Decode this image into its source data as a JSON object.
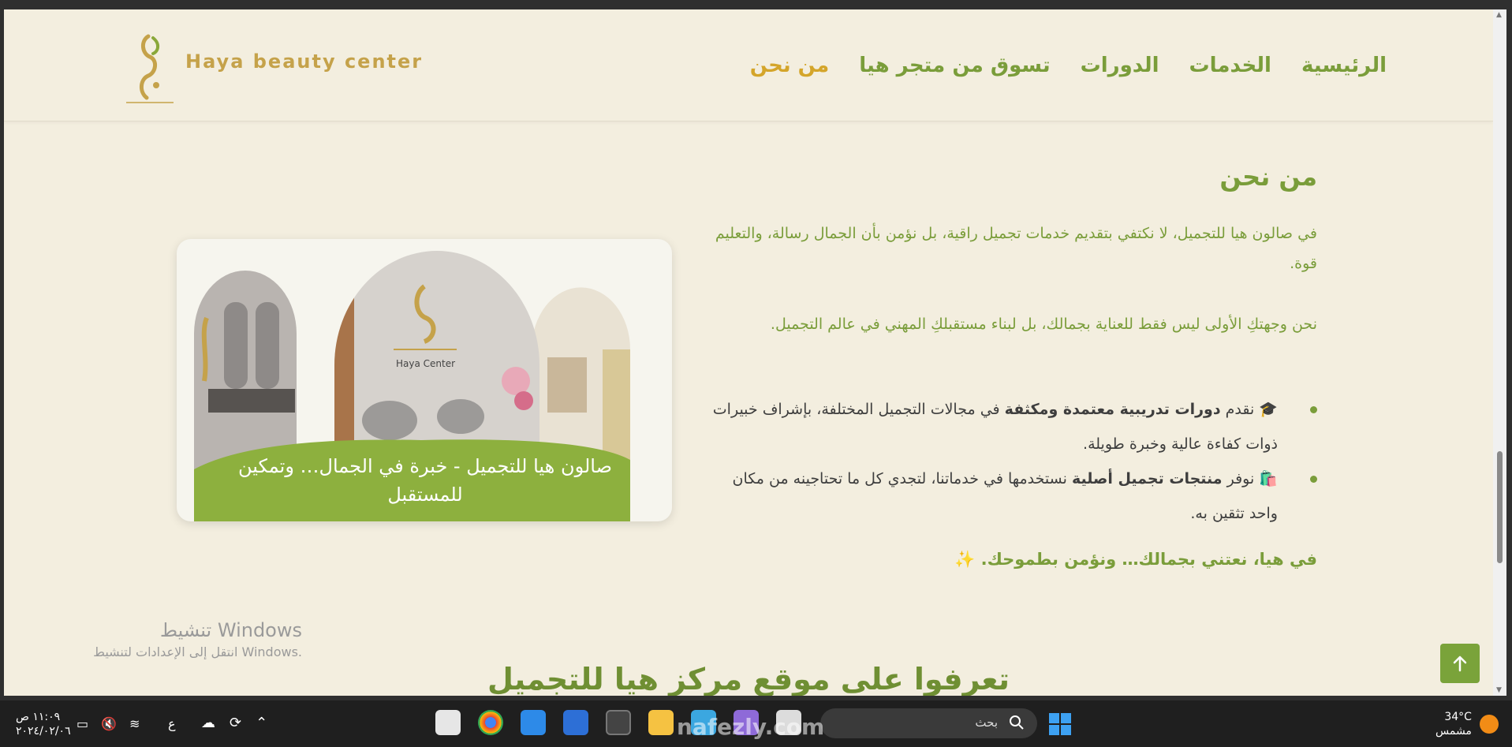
{
  "header": {
    "brand": "Haya beauty center",
    "nav": [
      {
        "label": "الرئيسية"
      },
      {
        "label": "الخدمات"
      },
      {
        "label": "الدورات"
      },
      {
        "label": "تسوق من متجر هيا"
      },
      {
        "label": "من نحن"
      }
    ],
    "active_index": 4
  },
  "about": {
    "title": "من نحن",
    "p1": "في صالون هيا للتجميل، لا نكتفي بتقديم خدمات تجميل راقية، بل نؤمن بأن الجمال رسالة، والتعليم قوة.",
    "p2": "نحن وجهتكِ الأولى ليس فقط للعناية بجمالك، بل لبناء مستقبلكِ المهني في عالم التجميل.",
    "li1": {
      "icon": "graduation-cap-icon",
      "pre": "نقدم ",
      "bold": "دورات تدريبية معتمدة ومكثفة",
      "post": " في مجالات التجميل المختلفة، بإشراف خبيرات ذوات كفاءة عالية وخبرة طويلة."
    },
    "li2": {
      "icon": "shopping-bag-icon",
      "pre": "نوفر ",
      "bold": "منتجات تجميل أصلية",
      "post": " نستخدمها في خدماتنا، لتجدي كل ما تحتاجينه من مكان واحد تثقين به."
    },
    "closing": "في هيا، نعتني بجمالك… ونؤمن بطموحك.",
    "closing_icon": "sparkles-icon"
  },
  "image_card": {
    "caption": "صالون هيا للتجميل - خبرة في الجمال… وتمكين للمستقبل",
    "sign_text": "Haya Center"
  },
  "windows_activation": {
    "title": "تنشيط Windows",
    "subtitle": "انتقل إلى الإعدادات لتنشيط Windows."
  },
  "next_section": {
    "heading": "تعرفوا على موقع مركز هيا للتجميل"
  },
  "taskbar": {
    "time": "١١:٠٩ ص",
    "date": "٢٠٢٤/٠٢/٠٦",
    "lang": "ع",
    "search_placeholder": "بحث",
    "temperature": "34°C",
    "weather": "مشمس"
  },
  "watermark": "nafezly.com",
  "colors": {
    "bg": "#f3eedf",
    "green": "#7a9d3a",
    "gold": "#d4a52a"
  }
}
